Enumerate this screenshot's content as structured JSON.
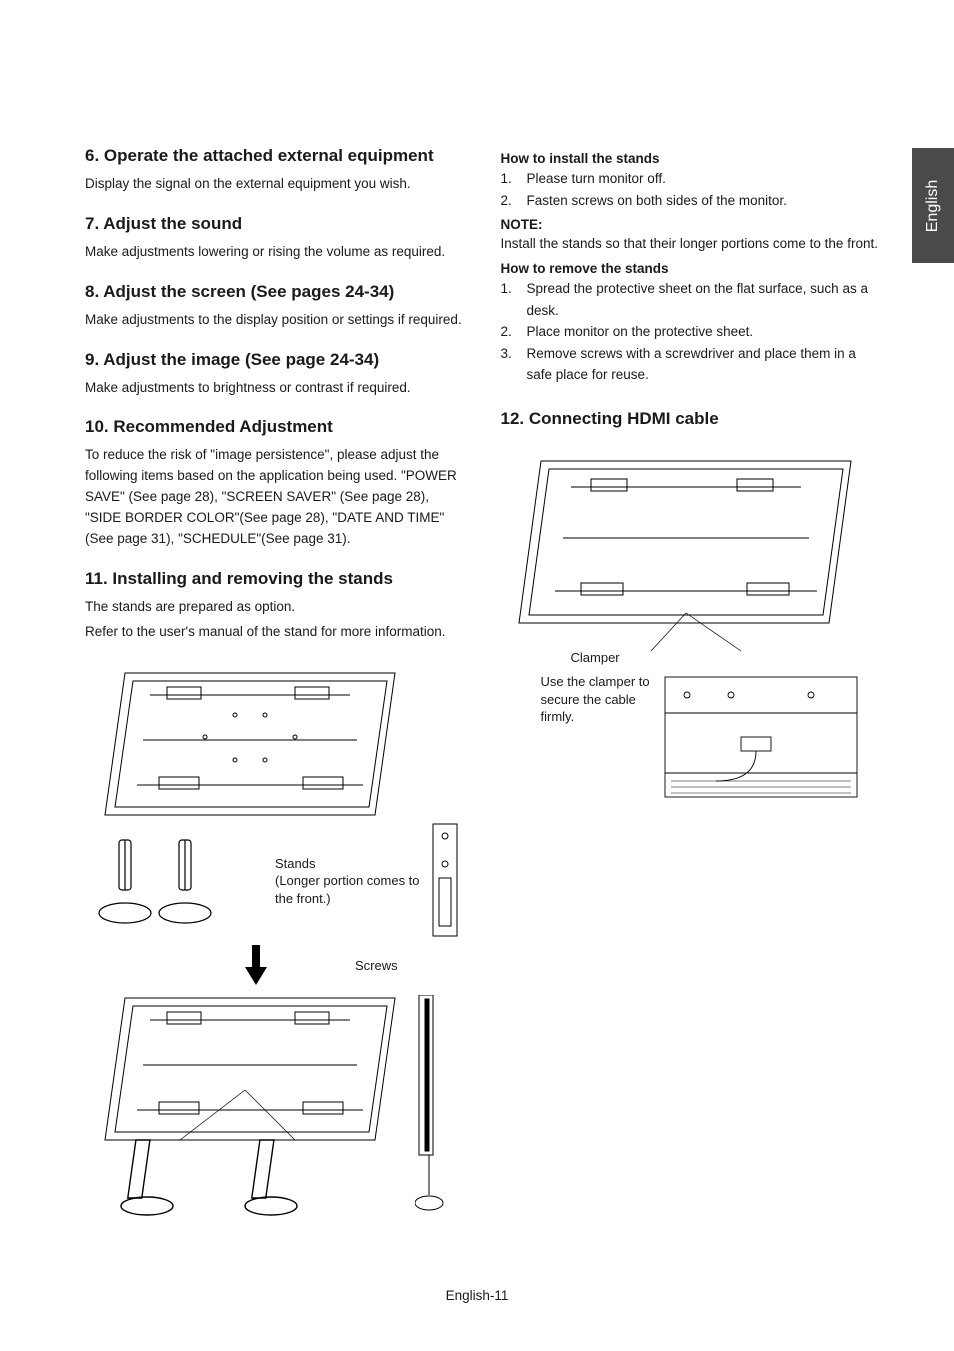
{
  "lang_tab": "English",
  "footer": "English-11",
  "left": {
    "s6": {
      "title": "6. Operate the attached external equipment",
      "body": "Display the signal on the external equipment you wish."
    },
    "s7": {
      "title": "7. Adjust the sound",
      "body": "Make adjustments lowering or rising the volume as required."
    },
    "s8": {
      "title": "8. Adjust the screen (See pages 24-34)",
      "body": "Make adjustments to the display position or settings if required."
    },
    "s9": {
      "title": "9. Adjust the image (See page 24-34)",
      "body": "Make adjustments to brightness or contrast if required."
    },
    "s10": {
      "title": "10. Recommended Adjustment",
      "body": "To reduce the risk of \"image persistence\", please adjust the following items based on the application being used. \"POWER SAVE\" (See page 28), \"SCREEN SAVER\" (See page 28), \"SIDE BORDER COLOR\"(See page 28), \"DATE AND TIME\" (See page 31), \"SCHEDULE\"(See page 31)."
    },
    "s11": {
      "title": "11. Installing and removing the stands",
      "body1": "The stands are prepared as option.",
      "body2": "Refer to the user's manual of the stand for more information.",
      "fig_stands_label": "Stands",
      "fig_stands_note": "(Longer portion comes to the front.)",
      "fig_screws_label": "Screws"
    }
  },
  "right": {
    "install": {
      "heading": "How to install the stands",
      "items": [
        "Please turn monitor off.",
        "Fasten screws on both sides of the monitor."
      ]
    },
    "note_heading": "NOTE:",
    "note_body": "Install the stands so that their longer portions come to the front.",
    "remove": {
      "heading": "How to remove the stands",
      "items": [
        "Spread the protective sheet on the flat surface, such as a desk.",
        "Place monitor on the protective sheet.",
        "Remove screws with a screwdriver and place them in a safe place for reuse."
      ]
    },
    "s12": {
      "title": "12. Connecting HDMI cable",
      "fig_clamper_label": "Clamper",
      "fig_clamper_note": "Use the clamper to secure the cable firmly."
    }
  }
}
